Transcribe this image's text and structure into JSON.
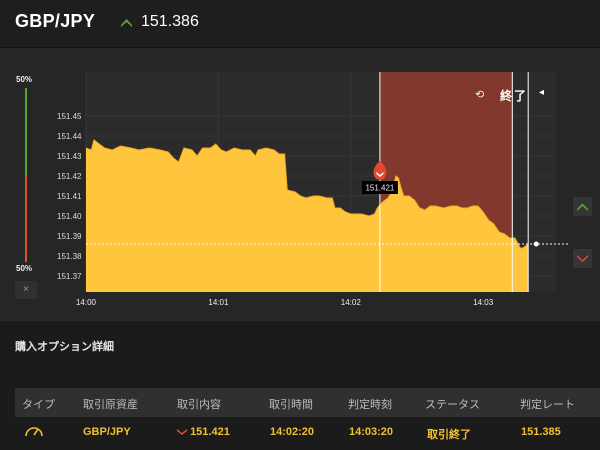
{
  "header": {
    "pair": "GBP/JPY",
    "rate": "151.386",
    "rate_arrow_icon": "up-chevron-icon",
    "arrow_color": "#5aa630"
  },
  "gauge": {
    "top_pct": "50%",
    "bottom_pct": "50%",
    "reset_label": "×"
  },
  "chart_data": {
    "type": "area",
    "y_ticks": [
      "151.37",
      "151.38",
      "151.39",
      "151.40",
      "151.41",
      "151.42",
      "151.43",
      "151.44",
      "151.45"
    ],
    "x_ticks": [
      "14:00",
      "14:01",
      "14:02",
      "14:03"
    ],
    "ylim": [
      151.362,
      151.472
    ],
    "xlim_min": [
      0,
      3.55
    ],
    "current_rate": 151.386,
    "entry_rate": 151.421,
    "entry_label": "151.421",
    "entry_time_min": 2.22,
    "expiry_time_min": 3.22,
    "end_time_min": 3.34,
    "fill_color": "#ffc53d",
    "expired_zone_color": "#8b3a2f",
    "series": [
      {
        "values": [
          [
            0.0,
            151.434
          ],
          [
            0.04,
            151.433
          ],
          [
            0.06,
            151.438
          ],
          [
            0.1,
            151.436
          ],
          [
            0.14,
            151.434
          ],
          [
            0.2,
            151.433
          ],
          [
            0.26,
            151.435
          ],
          [
            0.34,
            151.434
          ],
          [
            0.4,
            151.433
          ],
          [
            0.48,
            151.434
          ],
          [
            0.56,
            151.433
          ],
          [
            0.62,
            151.432
          ],
          [
            0.66,
            151.429
          ],
          [
            0.7,
            151.427
          ],
          [
            0.74,
            151.434
          ],
          [
            0.8,
            151.433
          ],
          [
            0.84,
            151.43
          ],
          [
            0.88,
            151.434
          ],
          [
            0.94,
            151.434
          ],
          [
            0.98,
            151.436
          ],
          [
            1.02,
            151.433
          ],
          [
            1.06,
            151.432
          ],
          [
            1.12,
            151.434
          ],
          [
            1.18,
            151.433
          ],
          [
            1.24,
            151.433
          ],
          [
            1.28,
            151.43
          ],
          [
            1.3,
            151.433
          ],
          [
            1.36,
            151.434
          ],
          [
            1.42,
            151.433
          ],
          [
            1.46,
            151.431
          ],
          [
            1.5,
            151.431
          ],
          [
            1.52,
            151.413
          ],
          [
            1.58,
            151.412
          ],
          [
            1.62,
            151.41
          ],
          [
            1.66,
            151.409
          ],
          [
            1.72,
            151.41
          ],
          [
            1.76,
            151.41
          ],
          [
            1.82,
            151.409
          ],
          [
            1.86,
            151.409
          ],
          [
            1.88,
            151.404
          ],
          [
            1.92,
            151.404
          ],
          [
            1.96,
            151.402
          ],
          [
            2.0,
            151.401
          ],
          [
            2.08,
            151.401
          ],
          [
            2.14,
            151.4
          ],
          [
            2.18,
            151.401
          ],
          [
            2.2,
            151.404
          ],
          [
            2.24,
            151.407
          ],
          [
            2.28,
            151.409
          ],
          [
            2.3,
            151.411
          ],
          [
            2.32,
            151.414
          ],
          [
            2.34,
            151.42
          ],
          [
            2.36,
            151.419
          ],
          [
            2.38,
            151.414
          ],
          [
            2.4,
            151.41
          ],
          [
            2.44,
            151.41
          ],
          [
            2.48,
            151.408
          ],
          [
            2.52,
            151.404
          ],
          [
            2.56,
            151.403
          ],
          [
            2.6,
            151.405
          ],
          [
            2.64,
            151.405
          ],
          [
            2.7,
            151.404
          ],
          [
            2.76,
            151.405
          ],
          [
            2.8,
            151.405
          ],
          [
            2.84,
            151.404
          ],
          [
            2.88,
            151.404
          ],
          [
            2.92,
            151.405
          ],
          [
            2.96,
            151.405
          ],
          [
            3.0,
            151.402
          ],
          [
            3.04,
            151.398
          ],
          [
            3.08,
            151.396
          ],
          [
            3.12,
            151.392
          ],
          [
            3.16,
            151.391
          ],
          [
            3.2,
            151.389
          ],
          [
            3.24,
            151.389
          ],
          [
            3.28,
            151.384
          ],
          [
            3.3,
            151.384
          ],
          [
            3.34,
            151.386
          ]
        ]
      }
    ]
  },
  "expired_label": "終了",
  "expired_icon": "history-icon",
  "high_button_icon": "up-chevron-icon",
  "low_button_icon": "down-chevron-icon",
  "details": {
    "title": "購入オプション詳細",
    "columns": [
      "タイプ",
      "取引原資産",
      "取引内容",
      "取引時間",
      "判定時刻",
      "ステータス",
      "判定レート"
    ],
    "row": {
      "type_icon": "gauge-icon",
      "asset": "GBP/JPY",
      "content_icon": "down-chevron-icon",
      "content": "151.421",
      "trade_time": "14:02:20",
      "judge_time": "14:03:20",
      "status": "取引終了",
      "judge_rate": "151.385"
    }
  }
}
